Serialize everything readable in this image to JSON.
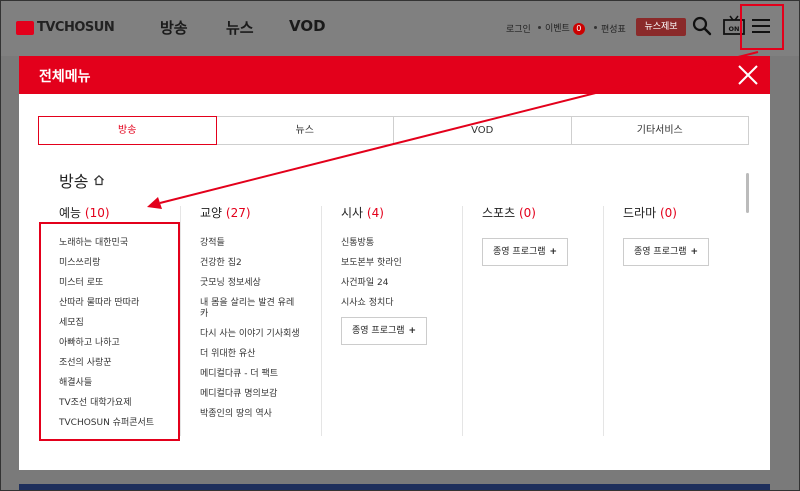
{
  "header": {
    "logo_text": "TVCHOSUN",
    "nav": [
      {
        "label": "방송"
      },
      {
        "label": "뉴스"
      },
      {
        "label": "VOD"
      }
    ],
    "utility": {
      "login": "로그인",
      "event": "이벤트",
      "event_badge": "0",
      "schedule": "편성표",
      "news_tip": "뉴스제보"
    },
    "onair_label": "ON"
  },
  "menu": {
    "title": "전체메뉴",
    "tabs": [
      {
        "label": "방송"
      },
      {
        "label": "뉴스"
      },
      {
        "label": "VOD"
      },
      {
        "label": "기타서비스"
      }
    ],
    "section_title": "방송",
    "columns": [
      {
        "title": "예능",
        "count": "(10)",
        "items": [
          "노래하는 대한민국",
          "미스쓰리랑",
          "미스터 로또",
          "산따라 물따라 딴따라",
          "세모집",
          "아빠하고 나하고",
          "조선의 사랑꾼",
          "해결사들",
          "TV조선 대학가요제",
          "TVCHOSUN 슈퍼콘서트"
        ]
      },
      {
        "title": "교양",
        "count": "(27)",
        "items": [
          "강적들",
          "건강한 집2",
          "굿모닝 정보세상",
          "내 몸을 살리는 발견 유레카",
          "다시 사는 이야기 기사회생",
          "더 위대한 유산",
          "메디컬다큐 - 더 팩트",
          "메디컬다큐 명의보감",
          "박종인의 땅의 역사"
        ]
      },
      {
        "title": "시사",
        "count": "(4)",
        "items": [
          "신통방통",
          "보도본부 핫라인",
          "사건파일 24",
          "시사쇼 정치다"
        ],
        "button": "종영 프로그램"
      },
      {
        "title": "스포츠",
        "count": "(0)",
        "items": [],
        "button": "종영 프로그램"
      },
      {
        "title": "드라마",
        "count": "(0)",
        "items": [],
        "button": "종영 프로그램"
      }
    ]
  },
  "colors": {
    "accent": "#e3001b",
    "overlay": "#808080"
  }
}
